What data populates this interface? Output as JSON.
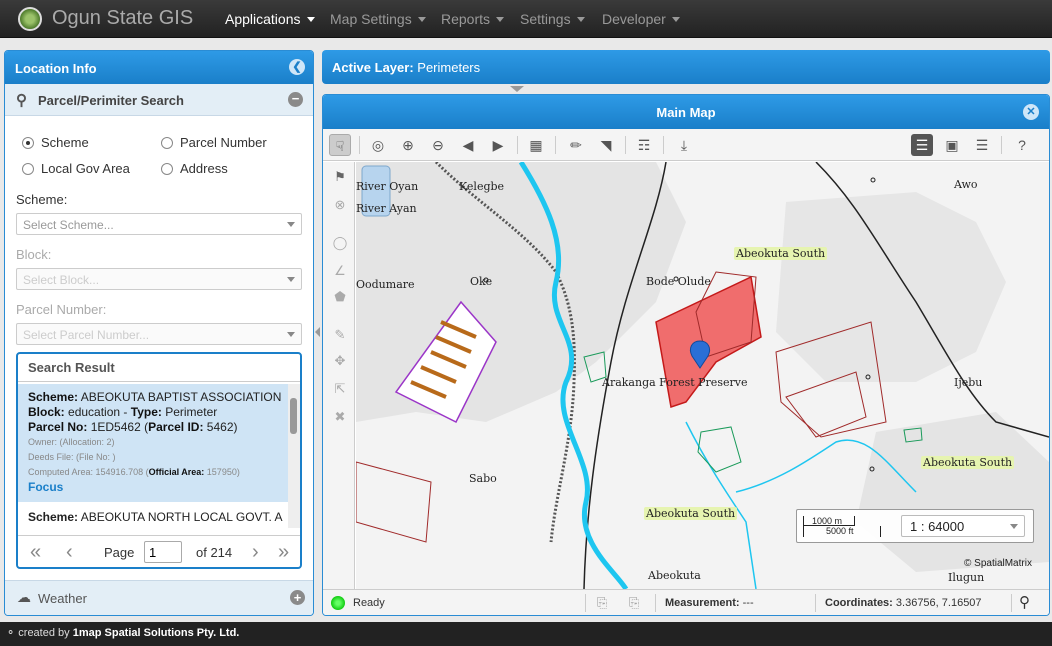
{
  "app": {
    "brand": "Ogun State GIS",
    "menu": [
      {
        "label": "Applications",
        "active": true
      },
      {
        "label": "Map Settings",
        "active": false
      },
      {
        "label": "Reports",
        "active": false
      },
      {
        "label": "Settings",
        "active": false
      },
      {
        "label": "Developer",
        "active": false
      }
    ]
  },
  "location_panel": {
    "title": "Location Info",
    "search_title": "Parcel/Perimiter Search",
    "radios": [
      {
        "label": "Scheme",
        "checked": true
      },
      {
        "label": "Parcel Number",
        "checked": false
      },
      {
        "label": "Local Gov Area",
        "checked": false
      },
      {
        "label": "Address",
        "checked": false
      }
    ],
    "scheme_label": "Scheme:",
    "scheme_placeholder": "Select Scheme...",
    "block_label": "Block:",
    "block_placeholder": "Select Block...",
    "parcel_label": "Parcel Number:",
    "parcel_placeholder": "Select Parcel Number...",
    "result_title": "Search Result",
    "result": {
      "scheme_key": "Scheme:",
      "scheme": "ABEOKUTA BAPTIST ASSOCIATION",
      "block_key": "Block:",
      "block": "education",
      "type_key": "Type:",
      "type": "Perimeter",
      "parcel_no_key": "Parcel No:",
      "parcel_no": "1ED5462",
      "parcel_id_key": "Parcel ID:",
      "parcel_id": "5462",
      "owner": "Owner: (Allocation: 2)",
      "deeds": "Deeds File: (File No: )",
      "area_text": "Computed Area: 154916.708",
      "official_area_key": "Official Area:",
      "official_area": "157950",
      "focus_label": "Focus"
    },
    "result2_key": "Scheme:",
    "result2_value": "ABEOKUTA NORTH LOCAL GOVT. A",
    "pager": {
      "page_label": "Page",
      "page": "1",
      "of_label": "of 214"
    },
    "weather_label": "Weather"
  },
  "active_layer": {
    "label": "Active Layer:",
    "value": "Perimeters"
  },
  "map": {
    "title": "Main Map",
    "places": [
      "River Oyan",
      "Kelegbe",
      "River Ayan",
      "Awo",
      "Abeokuta South",
      "Oodumare",
      "Oke",
      "Bode Olude",
      "Arakanga Forest Preserve",
      "Ijebu",
      "Abeokuta South",
      "Sabo",
      "Abeokuta South",
      "Abeokuta",
      "Ilugun"
    ],
    "scale_1": "1000 m",
    "scale_2": "5000 ft",
    "scale_ratio": "1 : 64000",
    "copyright": "© SpatialMatrix"
  },
  "status": {
    "ready": "Ready",
    "measurement_label": "Measurement:",
    "measurement_value": "---",
    "coordinates_label": "Coordinates:",
    "coordinates_value": "3.36756, 7.16507"
  },
  "footer": {
    "prefix": "created by",
    "company": "1map Spatial Solutions Pty. Ltd."
  }
}
